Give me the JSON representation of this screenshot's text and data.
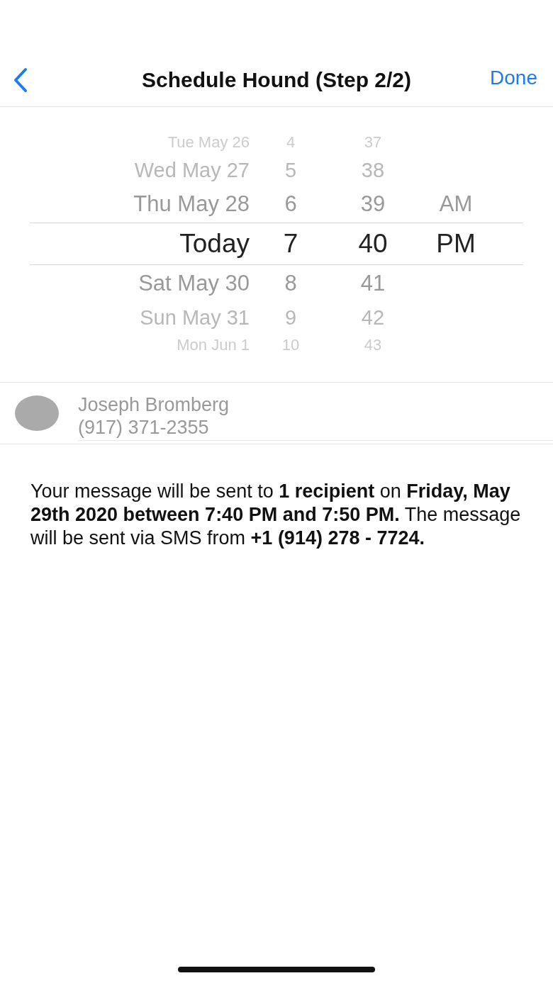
{
  "nav": {
    "title": "Schedule Hound (Step 2/2)",
    "done": "Done"
  },
  "picker": {
    "rows": [
      {
        "date": "Tue May 26",
        "hour": "4",
        "minute": "37",
        "selected": false
      },
      {
        "date": "Wed May 27",
        "hour": "5",
        "minute": "38",
        "selected": false
      },
      {
        "date": "Thu May 28",
        "hour": "6",
        "minute": "39",
        "period": "AM",
        "selected": false
      },
      {
        "date": "Today",
        "hour": "7",
        "minute": "40",
        "period": "PM",
        "selected": true
      },
      {
        "date": "Sat May 30",
        "hour": "8",
        "minute": "41",
        "selected": false
      },
      {
        "date": "Sun May 31",
        "hour": "9",
        "minute": "42",
        "selected": false
      },
      {
        "date": "Mon Jun 1",
        "hour": "10",
        "minute": "43",
        "selected": false
      }
    ]
  },
  "recipient": {
    "name": "Joseph Bromberg",
    "phone": "(917) 371-2355"
  },
  "message": "Your message will be sent to **1 recipient** on **Friday, May 29th 2020 between 7:40 PM and 7:50 PM.** The message will be sent via SMS from **+1 (914) 278 - 7724.**"
}
